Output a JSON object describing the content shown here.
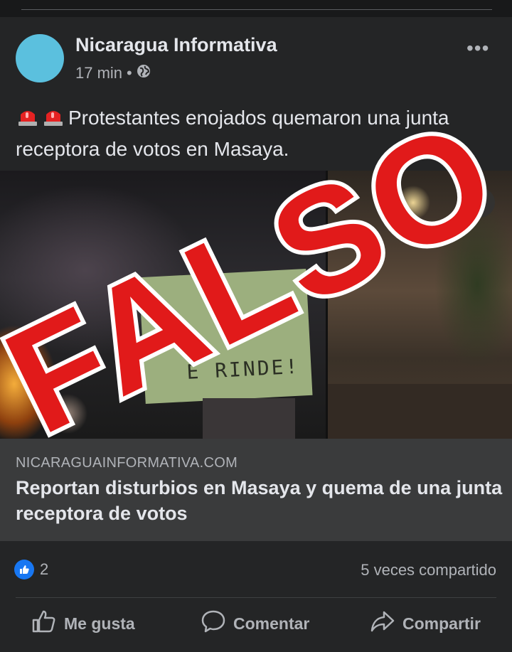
{
  "post": {
    "author": "Nicaragua Informativa",
    "time": "17 min",
    "separator": "•",
    "privacy_icon": "globe-icon",
    "more_label": "•••",
    "text": "Protestantes enojados quemaron una junta receptora de votos en Masaya.",
    "emoji_prefix": "🚨 🚨"
  },
  "image": {
    "banner_text": "E RINDE!",
    "info_label": "i",
    "stamp_text": "FALSO",
    "stamp_color": "#e11a1a"
  },
  "link": {
    "domain": "NICARAGUAINFORMATIVA.COM",
    "title": "Reportan disturbios en Masaya y quema de una junta receptora de votos"
  },
  "stats": {
    "reaction_icon": "thumbs-up-icon",
    "reactions_count": "2",
    "shares": "5 veces compartido"
  },
  "actions": {
    "like_label": "Me gusta",
    "comment_label": "Comentar",
    "share_label": "Compartir"
  },
  "colors": {
    "background": "#18191a",
    "card": "#242526",
    "link_box": "#3a3b3c",
    "accent_blue": "#1877f2",
    "avatar": "#5bc0de"
  }
}
